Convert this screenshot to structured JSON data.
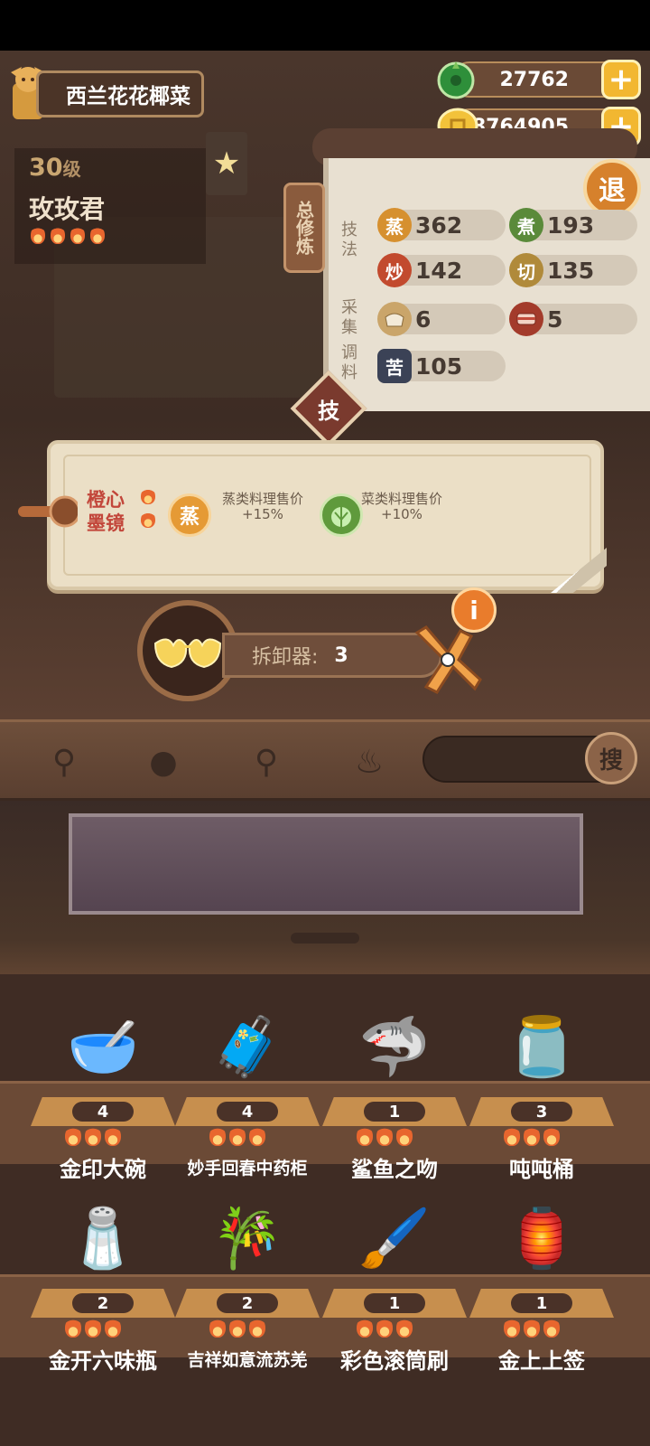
{
  "player": {
    "restaurant_name": "西兰花花椰菜",
    "level": "30",
    "level_unit": "级",
    "nickname": "玫玫君"
  },
  "currency": {
    "jade": "27762",
    "coins": "8764905"
  },
  "skills_panel": {
    "tag_label": "总修炼",
    "exit_label": "退",
    "section_technique": "技法",
    "section_gather": "采集",
    "section_season": "调料",
    "skills": [
      {
        "icon": "蒸",
        "value": "362",
        "color": "#d6902f"
      },
      {
        "icon": "煮",
        "value": "193",
        "color": "#5a8a3a"
      },
      {
        "icon": "炒",
        "value": "142",
        "color": "#c24a2e"
      },
      {
        "icon": "切",
        "value": "135",
        "color": "#b08a3a"
      },
      {
        "icon": "rice-icon",
        "value": "6",
        "color": "#caa56a"
      },
      {
        "icon": "meat-icon",
        "value": "5",
        "color": "#a33b2b"
      },
      {
        "icon": "苦",
        "value": "105",
        "color": "#3b4256"
      }
    ],
    "tech_tab": "技"
  },
  "popup": {
    "item_name": "橙心墨镜",
    "effects": [
      {
        "icon": "蒸",
        "text": "蒸类料理售价+15%",
        "color": "#e59a35"
      },
      {
        "icon": "cabbage-icon",
        "text": "菜类料理售价+10%",
        "color": "#5f9a3c"
      }
    ]
  },
  "dismantle": {
    "label": "拆卸器:",
    "count": "3"
  },
  "search": {
    "button": "搜"
  },
  "items": [
    {
      "name": "金印大碗",
      "count": "4",
      "icon": "bowl-icon",
      "glyph": "🥣"
    },
    {
      "name": "妙手回春中药柜",
      "count": "4",
      "icon": "cabinet-icon",
      "glyph": "🧳"
    },
    {
      "name": "鲨鱼之吻",
      "count": "1",
      "icon": "shark-icon",
      "glyph": "🦈"
    },
    {
      "name": "吨吨桶",
      "count": "3",
      "icon": "bottle-icon",
      "glyph": "🫙"
    },
    {
      "name": "金开六味瓶",
      "count": "2",
      "icon": "shaker-icon",
      "glyph": "🧂"
    },
    {
      "name": "吉祥如意流苏羌",
      "count": "2",
      "icon": "flute-icon",
      "glyph": "🎋"
    },
    {
      "name": "彩色滚筒刷",
      "count": "1",
      "icon": "roller-icon",
      "glyph": "🖌️"
    },
    {
      "name": "金上上签",
      "count": "1",
      "icon": "lots-icon",
      "glyph": "🏮"
    }
  ]
}
